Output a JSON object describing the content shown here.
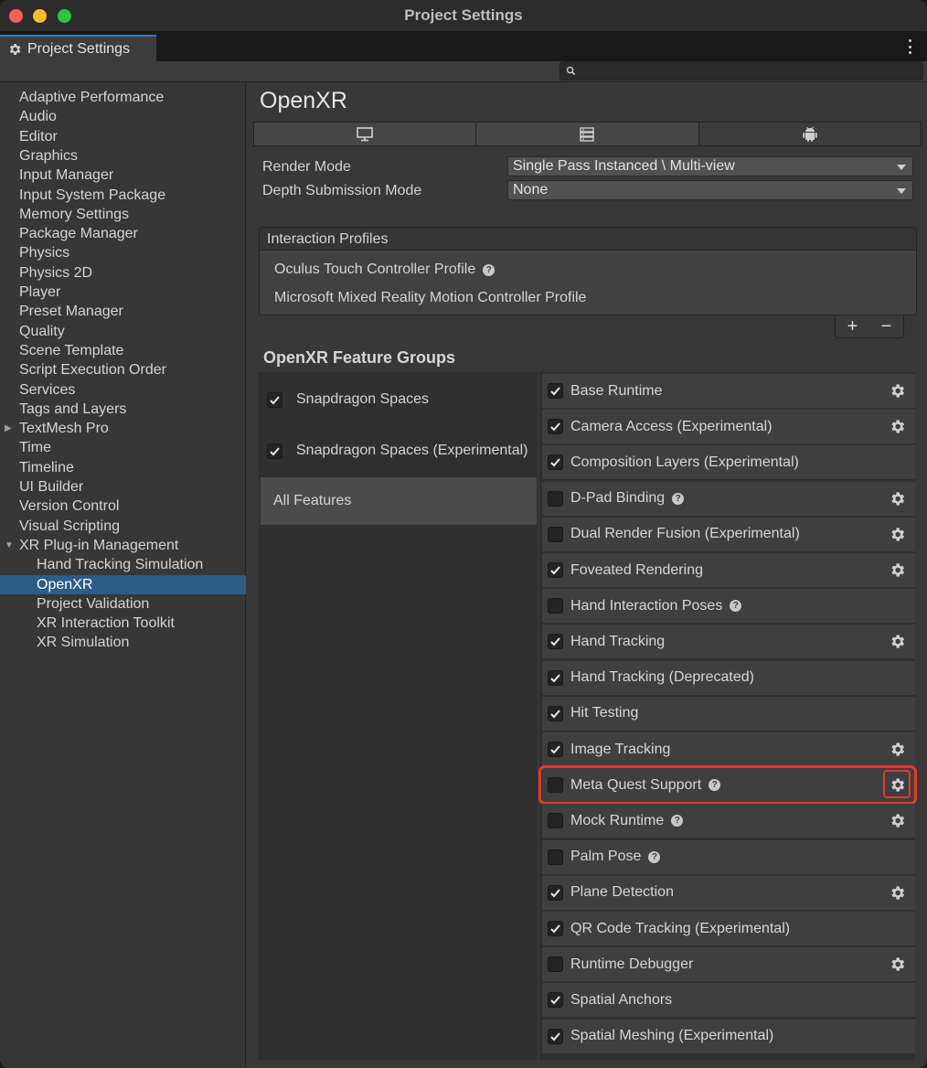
{
  "window": {
    "title": "Project Settings"
  },
  "tab": {
    "label": "Project Settings"
  },
  "search": {
    "value": ""
  },
  "sidebar": {
    "items": [
      {
        "label": "Adaptive Performance",
        "indent": 0
      },
      {
        "label": "Audio",
        "indent": 0
      },
      {
        "label": "Editor",
        "indent": 0
      },
      {
        "label": "Graphics",
        "indent": 0
      },
      {
        "label": "Input Manager",
        "indent": 0
      },
      {
        "label": "Input System Package",
        "indent": 0
      },
      {
        "label": "Memory Settings",
        "indent": 0
      },
      {
        "label": "Package Manager",
        "indent": 0
      },
      {
        "label": "Physics",
        "indent": 0
      },
      {
        "label": "Physics 2D",
        "indent": 0
      },
      {
        "label": "Player",
        "indent": 0
      },
      {
        "label": "Preset Manager",
        "indent": 0
      },
      {
        "label": "Quality",
        "indent": 0
      },
      {
        "label": "Scene Template",
        "indent": 0
      },
      {
        "label": "Script Execution Order",
        "indent": 0
      },
      {
        "label": "Services",
        "indent": 0
      },
      {
        "label": "Tags and Layers",
        "indent": 0
      },
      {
        "label": "TextMesh Pro",
        "indent": 0,
        "arrow": "collapsed"
      },
      {
        "label": "Time",
        "indent": 0
      },
      {
        "label": "Timeline",
        "indent": 0
      },
      {
        "label": "UI Builder",
        "indent": 0
      },
      {
        "label": "Version Control",
        "indent": 0
      },
      {
        "label": "Visual Scripting",
        "indent": 0
      },
      {
        "label": "XR Plug-in Management",
        "indent": 0,
        "arrow": "expanded"
      },
      {
        "label": "Hand Tracking Simulation",
        "indent": 1
      },
      {
        "label": "OpenXR",
        "indent": 1,
        "selected": true
      },
      {
        "label": "Project Validation",
        "indent": 1
      },
      {
        "label": "XR Interaction Toolkit",
        "indent": 1
      },
      {
        "label": "XR Simulation",
        "indent": 1
      }
    ]
  },
  "main": {
    "title": "OpenXR",
    "platform_tabs": [
      {
        "icon": "desktop-icon"
      },
      {
        "icon": "server-icon"
      },
      {
        "icon": "android-icon",
        "selected": true
      }
    ],
    "render_mode": {
      "label": "Render Mode",
      "value": "Single Pass Instanced \\ Multi-view"
    },
    "depth_mode": {
      "label": "Depth Submission Mode",
      "value": "None"
    },
    "interaction_profiles": {
      "header": "Interaction Profiles",
      "items": [
        {
          "label": "Oculus Touch Controller Profile",
          "help": true
        },
        {
          "label": "Microsoft Mixed Reality Motion Controller Profile",
          "help": false
        }
      ],
      "add_label": "+",
      "remove_label": "−"
    },
    "feature_groups_title": "OpenXR Feature Groups",
    "groups": [
      {
        "label": "Snapdragon Spaces",
        "checked": true
      },
      {
        "label": "Snapdragon Spaces (Experimental)",
        "checked": true
      },
      {
        "label": "All Features",
        "all": true
      }
    ],
    "features": [
      {
        "label": "Base Runtime",
        "checked": true,
        "gear": true
      },
      {
        "label": "Camera Access (Experimental)",
        "checked": true,
        "gear": true
      },
      {
        "label": "Composition Layers (Experimental)",
        "checked": true
      },
      {
        "label": "D-Pad Binding",
        "checked": false,
        "help": true,
        "gear": true
      },
      {
        "label": "Dual Render Fusion (Experimental)",
        "checked": false,
        "gear": true
      },
      {
        "label": "Foveated Rendering",
        "checked": true,
        "gear": true
      },
      {
        "label": "Hand Interaction Poses",
        "checked": false,
        "help": true
      },
      {
        "label": "Hand Tracking",
        "checked": true,
        "gear": true
      },
      {
        "label": "Hand Tracking (Deprecated)",
        "checked": true
      },
      {
        "label": "Hit Testing",
        "checked": true
      },
      {
        "label": "Image Tracking",
        "checked": true,
        "gear": true
      },
      {
        "label": "Meta Quest Support",
        "checked": false,
        "help": true,
        "gear": true,
        "highlighted": true
      },
      {
        "label": "Mock Runtime",
        "checked": false,
        "help": true,
        "gear": true
      },
      {
        "label": "Palm Pose",
        "checked": false,
        "help": true
      },
      {
        "label": "Plane Detection",
        "checked": true,
        "gear": true
      },
      {
        "label": "QR Code Tracking (Experimental)",
        "checked": true
      },
      {
        "label": "Runtime Debugger",
        "checked": false,
        "gear": true
      },
      {
        "label": "Spatial Anchors",
        "checked": true
      },
      {
        "label": "Spatial Meshing (Experimental)",
        "checked": true
      }
    ]
  }
}
